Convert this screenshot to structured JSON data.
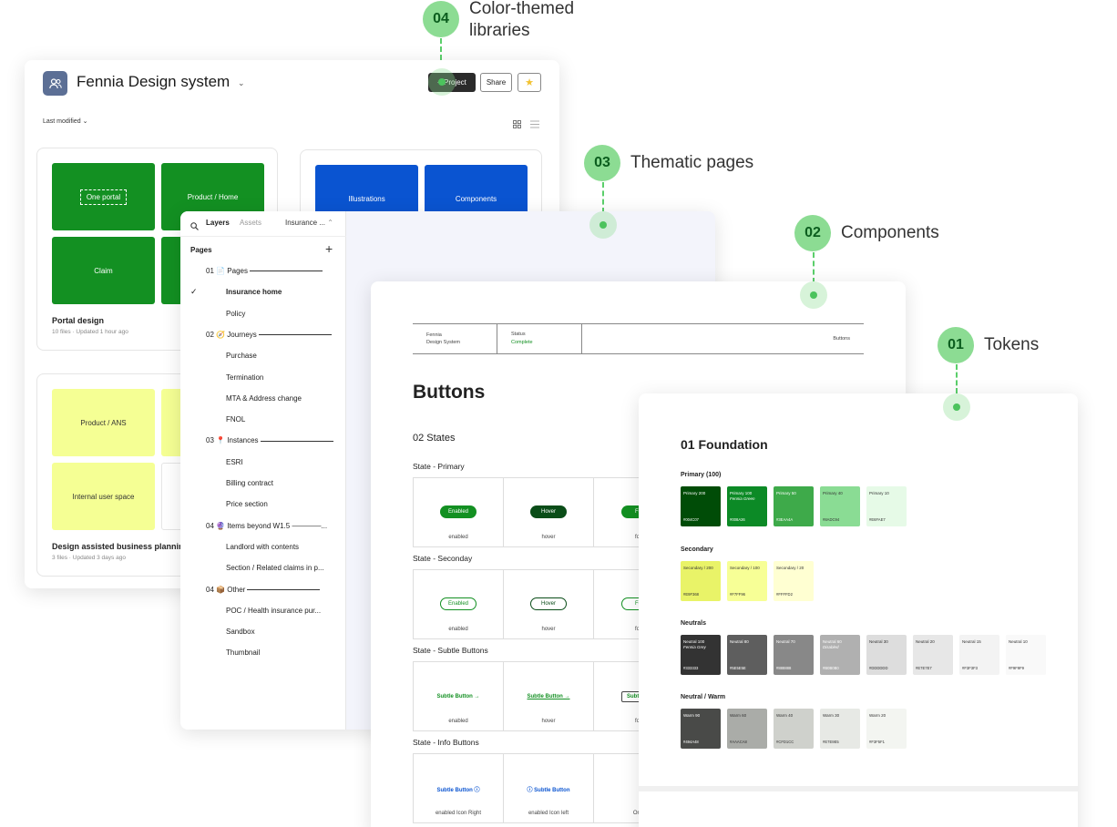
{
  "callouts": [
    {
      "num": "04",
      "label": "Color-themed libraries"
    },
    {
      "num": "03",
      "label": "Thematic pages"
    },
    {
      "num": "02",
      "label": "Components"
    },
    {
      "num": "01",
      "label": "Tokens"
    }
  ],
  "project": {
    "title": "Fennia Design system",
    "new_project": "+ Project",
    "share": "Share",
    "sort": "Last modified",
    "cards": [
      {
        "title": "Portal design",
        "meta": "10 files · Updated 1 hour ago",
        "tiles": [
          "One portal",
          "Product / Home",
          "Claim",
          ""
        ]
      },
      {
        "title": "",
        "meta": "",
        "tiles": [
          "Illustrations",
          "Components"
        ]
      },
      {
        "title": "Design assisted business planning",
        "meta": "3 files · Updated 3 days ago",
        "tiles": [
          "Product / ANS",
          "",
          "Internal user space",
          ""
        ]
      }
    ]
  },
  "layers": {
    "tab_layers": "Layers",
    "tab_assets": "Assets",
    "file": "Insurance ...",
    "pages_label": "Pages",
    "items": [
      {
        "text": "01 📄 Pages",
        "section": true
      },
      {
        "text": "Insurance home",
        "selected": true
      },
      {
        "text": "Policy"
      },
      {
        "text": "02 🧭 Journeys",
        "section": true
      },
      {
        "text": "Purchase"
      },
      {
        "text": "Termination"
      },
      {
        "text": "MTA & Address change"
      },
      {
        "text": "FNOL"
      },
      {
        "text": "03 📍 Instances",
        "section": true
      },
      {
        "text": "ESRI"
      },
      {
        "text": "Billing contract"
      },
      {
        "text": "Price section"
      },
      {
        "text": "04 🔮 Items beyond W1.5 ————...",
        "section": true,
        "noline": true
      },
      {
        "text": "Landlord with contents"
      },
      {
        "text": "Section / Related claims in p..."
      },
      {
        "text": "04 📦 Other",
        "section": true
      },
      {
        "text": "POC / Health insurance pur..."
      },
      {
        "text": "Sandbox"
      },
      {
        "text": "Thumbnail"
      }
    ]
  },
  "components": {
    "header": {
      "brand": "Fennia\nDesign System",
      "status_label": "Status",
      "status_value": "Complete",
      "page": "Buttons"
    },
    "title": "Buttons",
    "subtitle": "02 States",
    "rows": [
      {
        "label": "State - Primary",
        "cells": [
          {
            "btn": "Enabled",
            "cap": "enabled"
          },
          {
            "btn": "Hover",
            "cap": "hover"
          },
          {
            "btn": "Foc",
            "cap": "foc"
          }
        ]
      },
      {
        "label": "State - Seconday",
        "cells": [
          {
            "btn": "Enabled",
            "cap": "enabled"
          },
          {
            "btn": "Hover",
            "cap": "hover"
          },
          {
            "btn": "Foc",
            "cap": "foc"
          }
        ]
      },
      {
        "label": "State - Subtle Buttons",
        "cells": [
          {
            "btn": "Subtle Button →",
            "cap": "enabled"
          },
          {
            "btn": "Subtle Button →",
            "cap": "hover"
          },
          {
            "btn": "Subtle Bu",
            "cap": "foc"
          }
        ]
      },
      {
        "label": "State - Info Buttons",
        "cells": [
          {
            "btn": "Subtle Button ⓘ",
            "cap": "enabled Icon Right"
          },
          {
            "btn": "ⓘ Subtle Button",
            "cap": "enabled Icon left"
          },
          {
            "btn": "ⓘ",
            "cap": "Only"
          }
        ]
      }
    ]
  },
  "tokens": {
    "title": "01 Foundation",
    "groups": [
      {
        "name": "Primary (100)",
        "swatches": [
          {
            "name": "Primary 200",
            "sub": "",
            "hex": "#004C07",
            "color": "#004C07",
            "light": true
          },
          {
            "name": "Primary 100",
            "sub": "Fennia Green",
            "hex": "#008A26",
            "color": "#0C8A26",
            "light": true
          },
          {
            "name": "Primary 50",
            "sub": "",
            "hex": "#3EAA4A",
            "color": "#3EAA4A",
            "light": true
          },
          {
            "name": "Primary 40",
            "sub": "",
            "hex": "#8ADC94",
            "color": "#8ADC94",
            "light": false
          },
          {
            "name": "Primary 10",
            "sub": "",
            "hex": "#E6FAE7",
            "color": "#E6FAE7",
            "light": false
          }
        ]
      },
      {
        "name": "Secondary",
        "swatches": [
          {
            "name": "Secondary / 200",
            "sub": "",
            "hex": "#E9F368",
            "color": "#E9F368",
            "light": false
          },
          {
            "name": "Secondary / 100",
            "sub": "",
            "hex": "#F7FF96",
            "color": "#F7FF96",
            "light": false
          },
          {
            "name": "Secondary / 20",
            "sub": "",
            "hex": "#FFFFD2",
            "color": "#FFFFD2",
            "light": false
          }
        ]
      },
      {
        "name": "Neutrals",
        "swatches": [
          {
            "name": "Neutral 100",
            "sub": "Fennia Grey",
            "hex": "#333333",
            "color": "#333333",
            "light": true
          },
          {
            "name": "Neutral 80",
            "sub": "",
            "hex": "#5E5E5E",
            "color": "#5E5E5E",
            "light": true
          },
          {
            "name": "Neutral 70",
            "sub": "",
            "hex": "#888888",
            "color": "#888888",
            "light": true
          },
          {
            "name": "Neutral 60",
            "sub": "Disabled",
            "hex": "#B0B0B0",
            "color": "#B0B0B0",
            "light": true
          },
          {
            "name": "Neutral 30",
            "sub": "",
            "hex": "#DDDDDD",
            "color": "#DDDDDD",
            "light": false
          },
          {
            "name": "Neutral 20",
            "sub": "",
            "hex": "#E7E7E7",
            "color": "#E7E7E7",
            "light": false
          },
          {
            "name": "Neutral 15",
            "sub": "",
            "hex": "#F3F3F3",
            "color": "#F3F3F3",
            "light": false
          },
          {
            "name": "Neutral 10",
            "sub": "",
            "hex": "#F9F9F9",
            "color": "#F9F9F9",
            "light": false
          }
        ]
      },
      {
        "name": "Neutral / Warm",
        "swatches": [
          {
            "name": "Warm 90",
            "sub": "",
            "hex": "#494A48",
            "color": "#494A48",
            "light": true
          },
          {
            "name": "Warm 60",
            "sub": "",
            "hex": "#AAACA8",
            "color": "#AAACA8",
            "light": false
          },
          {
            "name": "Warm 40",
            "sub": "",
            "hex": "#CFD1CC",
            "color": "#CFD1CC",
            "light": false
          },
          {
            "name": "Warm 30",
            "sub": "",
            "hex": "#E7E9E5",
            "color": "#E7E9E5",
            "light": false
          },
          {
            "name": "Warm 20",
            "sub": "",
            "hex": "#F3F5F1",
            "color": "#F3F5F1",
            "light": false
          }
        ]
      }
    ]
  },
  "colors": {
    "accent_green": "#139022",
    "callout_green": "#8cdc93",
    "brand_blue": "#0a54d1",
    "yellow": "#f5ff94",
    "canvas_tint": "#f3f4fb"
  }
}
